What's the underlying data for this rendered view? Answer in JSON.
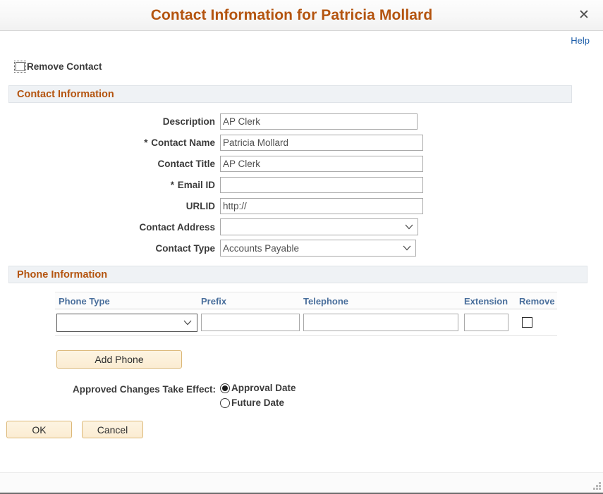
{
  "window": {
    "title": "Contact Information for Patricia Mollard",
    "close_icon": "close-icon",
    "close_glyph": "✕"
  },
  "help": {
    "label": "Help"
  },
  "remove_contact": {
    "label": "Remove Contact",
    "checked": false
  },
  "contact_section": {
    "title": "Contact Information",
    "fields": [
      {
        "label": "Description",
        "required": false,
        "type": "text",
        "value": "AP Clerk",
        "placeholder": ""
      },
      {
        "label": "Contact Name",
        "required": true,
        "type": "text",
        "value": "Patricia Mollard",
        "placeholder": ""
      },
      {
        "label": "Contact Title",
        "required": false,
        "type": "text",
        "value": "AP Clerk",
        "placeholder": ""
      },
      {
        "label": "Email ID",
        "required": true,
        "type": "text",
        "value": "",
        "placeholder": ""
      },
      {
        "label": "URLID",
        "required": false,
        "type": "text",
        "value": "http://",
        "placeholder": ""
      },
      {
        "label": "Contact Address",
        "required": false,
        "type": "select",
        "value": ""
      },
      {
        "label": "Contact Type",
        "required": false,
        "type": "select",
        "value": "Accounts Payable"
      }
    ],
    "required_marker": "*"
  },
  "phone_section": {
    "title": "Phone Information",
    "columns": [
      "Phone Type",
      "Prefix",
      "Telephone",
      "Extension",
      "Remove"
    ],
    "rows": [
      {
        "phone_type": "",
        "prefix": "",
        "telephone": "",
        "extension": "",
        "remove_checked": false
      }
    ],
    "add_phone_label": "Add Phone"
  },
  "approved_changes": {
    "label": "Approved Changes Take Effect:",
    "options": [
      {
        "label": "Approval Date",
        "selected": true
      },
      {
        "label": "Future Date",
        "selected": false
      }
    ]
  },
  "actions": {
    "ok_label": "OK",
    "cancel_label": "Cancel"
  },
  "colors": {
    "title_brown": "#b4540f",
    "section_header_text": "#b4540f",
    "section_header_bg": "#eff2f5",
    "table_header_blue": "#4a6f9c",
    "help_link_blue": "#1f5faa",
    "button_bg": "#fbecd2",
    "button_border": "#dcb878",
    "label_text": "#3b3b3b",
    "input_text": "#4f4f4f"
  }
}
